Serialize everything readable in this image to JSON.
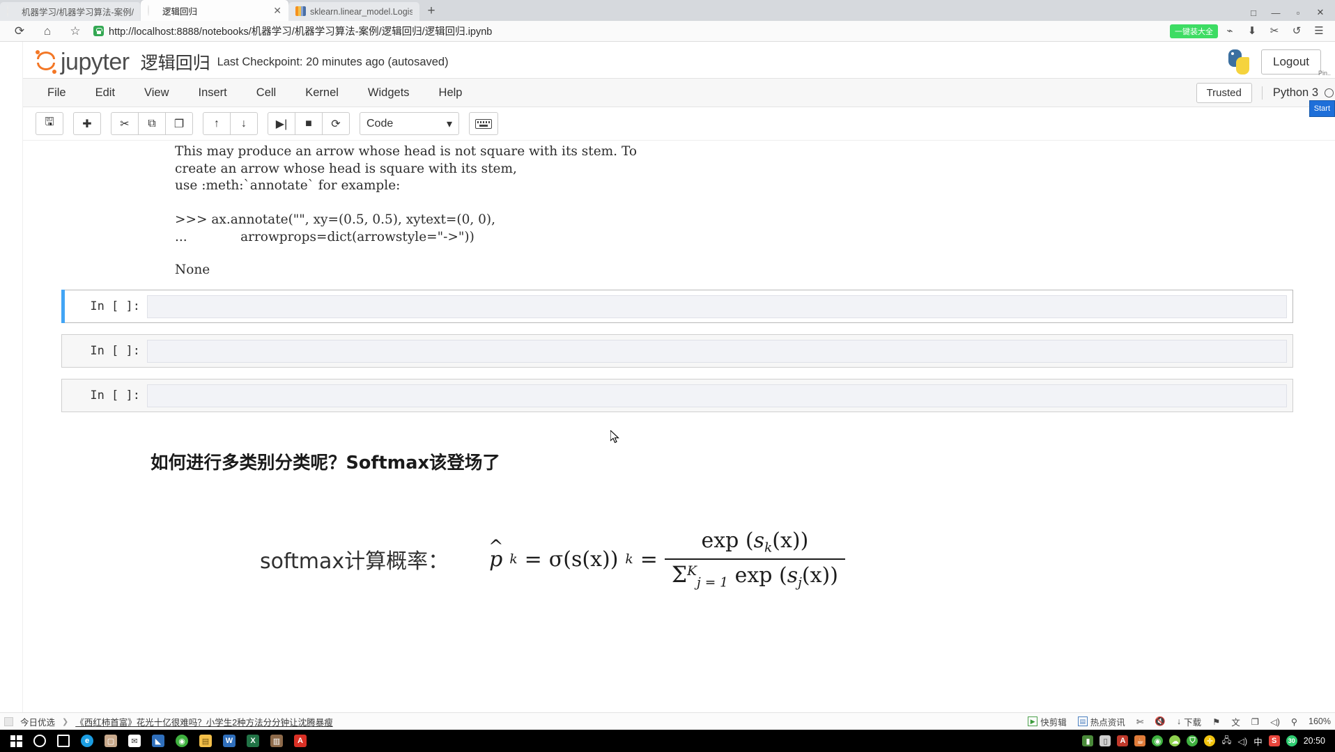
{
  "browser": {
    "tabs": [
      {
        "title": "机器学习/机器学习算法-案例/逻",
        "favicon": "jupyter-icon",
        "active": false
      },
      {
        "title": "逻辑回归",
        "favicon": "jupyter-icon",
        "active": true
      },
      {
        "title": "sklearn.linear_model.Logistic",
        "favicon": "sklearn-icon",
        "active": false
      }
    ],
    "new_tab_label": "+",
    "window_controls": [
      "□",
      "—",
      "▫",
      "✕"
    ],
    "nav": {
      "reload_icon": "reload-icon",
      "home_icon": "home-icon",
      "bookmark_icon": "star-icon"
    },
    "url": "http://localhost:8888/notebooks/机器学习/机器学习算法-案例/逻辑回归/逻辑回归.ipynb",
    "url_scheme": "http://",
    "url_host": "localhost",
    "url_rest": ":8888/notebooks/机器学习/机器学习算法-案例/逻辑回归/逻辑回归.ipynb",
    "security_icon": "shield-lock-icon",
    "badge_label": "一键装大全",
    "right_icons": [
      "share-icon",
      "download-icon",
      "extension-icon",
      "history-back-icon",
      "menu-icon"
    ]
  },
  "jupyter": {
    "logo_text": "jupyter",
    "notebook_name": "逻辑回归",
    "checkpoint": "Last Checkpoint: 20 minutes ago (autosaved)",
    "logout_label": "Logout",
    "python_logo": "python-icon",
    "menus": [
      "File",
      "Edit",
      "View",
      "Insert",
      "Cell",
      "Kernel",
      "Widgets",
      "Help"
    ],
    "trusted_label": "Trusted",
    "kernel_name": "Python 3",
    "kernel_status_icon": "kernel-idle-circle",
    "toolbar": {
      "groups": [
        [
          {
            "name": "save-button",
            "glyph": "🖫"
          }
        ],
        [
          {
            "name": "insert-cell-below-button",
            "glyph": "✚"
          }
        ],
        [
          {
            "name": "cut-cell-button",
            "glyph": "✂"
          },
          {
            "name": "copy-cell-button",
            "glyph": "⧉"
          },
          {
            "name": "paste-cell-button",
            "glyph": "❐"
          }
        ],
        [
          {
            "name": "move-cell-up-button",
            "glyph": "↑"
          },
          {
            "name": "move-cell-down-button",
            "glyph": "↓"
          }
        ],
        [
          {
            "name": "run-cell-button",
            "glyph": "▶|"
          },
          {
            "name": "interrupt-kernel-button",
            "glyph": "■"
          },
          {
            "name": "restart-kernel-button",
            "glyph": "⟳"
          }
        ]
      ],
      "cell_type_value": "Code",
      "cell_type_caret": "▾",
      "command_palette_icon": "keyboard-icon"
    }
  },
  "notebook": {
    "output_lines": [
      "This may produce an arrow whose head is not square with its stem. To",
      "create an arrow whose head is square with its stem,",
      "use :meth:`annotate` for example:",
      "",
      ">>> ax.annotate(\"\", xy=(0.5, 0.5), xytext=(0, 0),",
      "...             arrowprops=dict(arrowstyle=\"->\"))"
    ],
    "none_output": "None",
    "cells": [
      {
        "prompt": "In [ ]:",
        "value": "",
        "selected": true
      },
      {
        "prompt": "In [ ]:",
        "value": "",
        "selected": false
      },
      {
        "prompt": "In [ ]:",
        "value": "",
        "selected": false
      }
    ],
    "markdown_heading": "如何进行多类别分类呢？Softmax该登场了",
    "formula": {
      "label": "softmax计算概率：",
      "lhs_p": "p",
      "lhs_sub": "k",
      "eq1": "=",
      "sigma": "σ(s(x))",
      "sigma_sub": "k",
      "eq2": "=",
      "numerator_exp": "exp",
      "numerator_arg": "s",
      "numerator_sub": "k",
      "numerator_x": "(x)",
      "denominator_sum": "Σ",
      "denominator_sup": "K",
      "denominator_sub": "j = 1",
      "denominator_exp": "exp",
      "denominator_arg": "s",
      "denominator_argsub": "j",
      "denominator_x": "(x)"
    }
  },
  "newsbar": {
    "brand": "今日优选",
    "headline": "《西红柿首富》花光十亿很难吗？小学生2种方法分分钟让沈腾暴瘦",
    "right_items": [
      {
        "icon": "video-clip-icon",
        "label": "快剪辑"
      },
      {
        "icon": "hot-news-icon",
        "label": "热点资讯"
      },
      {
        "icon": "screenshot-icon",
        "label": ""
      },
      {
        "icon": "mute-icon",
        "label": ""
      },
      {
        "icon": "download-arrow-icon",
        "label": "下载"
      },
      {
        "icon": "flag-icon",
        "label": ""
      },
      {
        "icon": "translate-icon",
        "label": ""
      },
      {
        "icon": "window-icon",
        "label": ""
      },
      {
        "icon": "sound-icon",
        "label": ""
      },
      {
        "icon": "search-icon",
        "label": ""
      },
      {
        "icon": "zoom-level",
        "label": "160%"
      }
    ]
  },
  "taskbar": {
    "start_icon": "windows-start-icon",
    "items": [
      {
        "name": "cortana-icon",
        "glyph": "◯",
        "color": "#ffffff"
      },
      {
        "name": "task-view-icon",
        "glyph": "❏",
        "color": "#ffffff"
      },
      {
        "name": "edge-icon",
        "glyph": "e",
        "color": "#1b9de2"
      },
      {
        "name": "store-icon",
        "glyph": "🛍",
        "color": "#d8b8a0"
      },
      {
        "name": "mail-icon",
        "glyph": "✉",
        "color": "#ffffff"
      },
      {
        "name": "app-icon-blue",
        "glyph": "▣",
        "color": "#2f6fbc"
      },
      {
        "name": "browser-360-icon",
        "glyph": "◉",
        "color": "#3fb13f"
      },
      {
        "name": "file-explorer-icon",
        "glyph": "▤",
        "color": "#f4c04a"
      },
      {
        "name": "word-icon",
        "glyph": "W",
        "color": "#2b579a"
      },
      {
        "name": "excel-icon",
        "glyph": "X",
        "color": "#217346"
      },
      {
        "name": "media-icon",
        "glyph": "▥",
        "color": "#8d6a4a"
      },
      {
        "name": "pdf-icon",
        "glyph": "A",
        "color": "#d93025"
      }
    ],
    "tray": [
      {
        "name": "tray-app-icon",
        "glyph": "▮",
        "color": "#4a8a3a"
      },
      {
        "name": "tray-device-icon",
        "glyph": "▯",
        "color": "#cfcfcf"
      },
      {
        "name": "tray-pdf-icon",
        "glyph": "A",
        "color": "#c0392b"
      },
      {
        "name": "tray-java-icon",
        "glyph": "☕",
        "color": "#e07b39"
      },
      {
        "name": "tray-360-icon",
        "glyph": "◉",
        "color": "#3fb13f"
      },
      {
        "name": "tray-cloud-icon",
        "glyph": "☁",
        "color": "#8fd14f"
      },
      {
        "name": "tray-shield-icon",
        "glyph": "⛉",
        "color": "#3fb13f"
      },
      {
        "name": "tray-plus-icon",
        "glyph": "✛",
        "color": "#f1c40f"
      },
      {
        "name": "tray-network-icon",
        "glyph": "🖧",
        "color": "#dddddd"
      },
      {
        "name": "tray-volume-icon",
        "glyph": "🔊",
        "color": "#dddddd"
      },
      {
        "name": "tray-ime-icon",
        "glyph": "中",
        "color": "#ffffff"
      },
      {
        "name": "tray-sogou-icon",
        "glyph": "S",
        "color": "#e8453c"
      },
      {
        "name": "tray-temp-icon",
        "glyph": "30",
        "color": "#2ecc71"
      }
    ],
    "clock": "20:50"
  },
  "side_panel": {
    "pin_label": "Pin..",
    "start_label": "Start"
  },
  "colors": {
    "jupyter_orange": "#f37726",
    "selected_cell_blue": "#42a5f5",
    "badge_green": "#3ddc63",
    "taskbar_black": "#000000"
  }
}
